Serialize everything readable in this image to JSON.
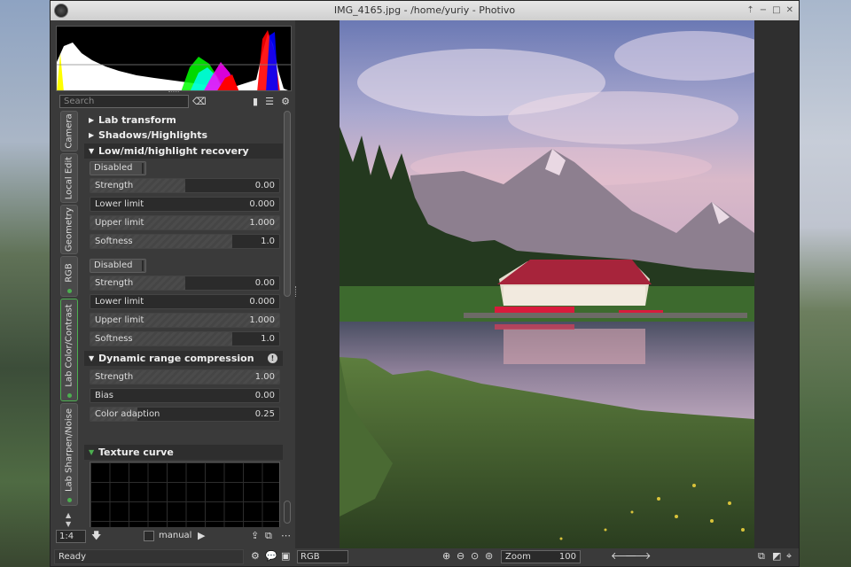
{
  "window": {
    "title": "IMG_4165.jpg - /home/yuriy - Photivo",
    "buttons": [
      "⇡",
      "−",
      "□",
      "✕"
    ]
  },
  "toolbar": {
    "search_placeholder": "Search"
  },
  "tabs": [
    {
      "label": "Camera"
    },
    {
      "label": "Local Edit"
    },
    {
      "label": "Geometry"
    },
    {
      "label": "RGB"
    },
    {
      "label": "Lab Color/Contrast"
    },
    {
      "label": "Lab Sharpen/Noise"
    }
  ],
  "sections": {
    "lab_transform": "Lab transform",
    "shadows_highlights": "Shadows/Highlights",
    "recovery": "Low/mid/highlight recovery",
    "drc": "Dynamic range compression",
    "texture": "Texture curve"
  },
  "recovery": {
    "group1": {
      "combo": "Disabled",
      "sliders": [
        {
          "label": "Strength",
          "value": "0.00",
          "fill": 0.5
        },
        {
          "label": "Lower limit",
          "value": "0.000",
          "fill": 0.0
        },
        {
          "label": "Upper limit",
          "value": "1.000",
          "fill": 1.0
        },
        {
          "label": "Softness",
          "value": "1.0",
          "fill": 0.75
        }
      ]
    },
    "group2": {
      "combo": "Disabled",
      "sliders": [
        {
          "label": "Strength",
          "value": "0.00",
          "fill": 0.5
        },
        {
          "label": "Lower limit",
          "value": "0.000",
          "fill": 0.0
        },
        {
          "label": "Upper limit",
          "value": "1.000",
          "fill": 1.0
        },
        {
          "label": "Softness",
          "value": "1.0",
          "fill": 0.75
        }
      ]
    }
  },
  "drc": {
    "sliders": [
      {
        "label": "Strength",
        "value": "1.00",
        "fill": 1.0
      },
      {
        "label": "Bias",
        "value": "0.00",
        "fill": 0.0
      },
      {
        "label": "Color adaption",
        "value": "0.25",
        "fill": 0.25
      }
    ]
  },
  "bottom": {
    "zoom_select": "1:4",
    "manual_label": "manual",
    "status": "Ready"
  },
  "viewer": {
    "channel": "RGB",
    "zoom_label": "Zoom",
    "zoom_value": "100"
  }
}
